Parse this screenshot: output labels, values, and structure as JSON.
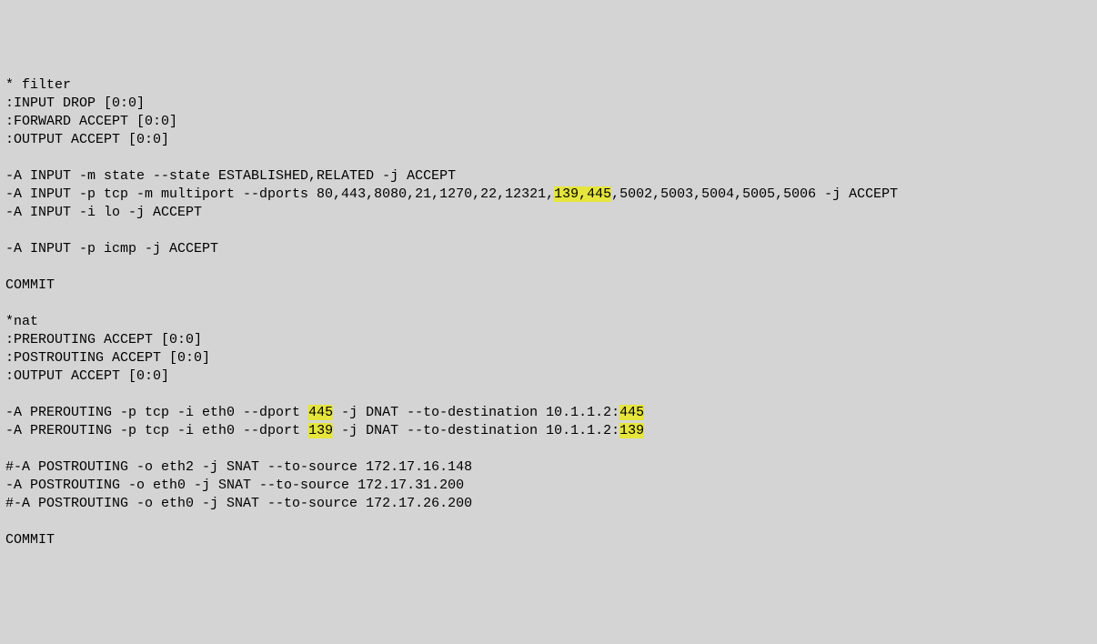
{
  "lines": {
    "l1": "* filter",
    "l2": ":INPUT DROP [0:0]",
    "l3": ":FORWARD ACCEPT [0:0]",
    "l4": ":OUTPUT ACCEPT [0:0]",
    "l5": "",
    "l6": "-A INPUT -m state --state ESTABLISHED,RELATED -j ACCEPT",
    "l7a": "-A INPUT -p tcp -m multiport --dports 80,443,8080,21,1270,22,12321,",
    "l7h": "139,445",
    "l7b": ",5002,5003,5004,5005,5006 -j ACCEPT",
    "l8": "-A INPUT -i lo -j ACCEPT",
    "l9": "",
    "l10": "-A INPUT -p icmp -j ACCEPT",
    "l11": "",
    "l12": "COMMIT",
    "l13": "",
    "l14": "*nat",
    "l15": ":PREROUTING ACCEPT [0:0]",
    "l16": ":POSTROUTING ACCEPT [0:0]",
    "l17": ":OUTPUT ACCEPT [0:0]",
    "l18": "",
    "l19a": "-A PREROUTING -p tcp -i eth0 --dport ",
    "l19h": "445",
    "l19b": " -j DNAT --to-destination 10.1.1.2:",
    "l19i": "445",
    "l20a": "-A PREROUTING -p tcp -i eth0 --dport ",
    "l20h": "139",
    "l20b": " -j DNAT --to-destination 10.1.1.2:",
    "l20i": "139",
    "l21": "",
    "l22": "#-A POSTROUTING -o eth2 -j SNAT --to-source 172.17.16.148",
    "l23": "-A POSTROUTING -o eth0 -j SNAT --to-source 172.17.31.200",
    "l24": "#-A POSTROUTING -o eth0 -j SNAT --to-source 172.17.26.200",
    "l25": "",
    "l26": "COMMIT"
  }
}
